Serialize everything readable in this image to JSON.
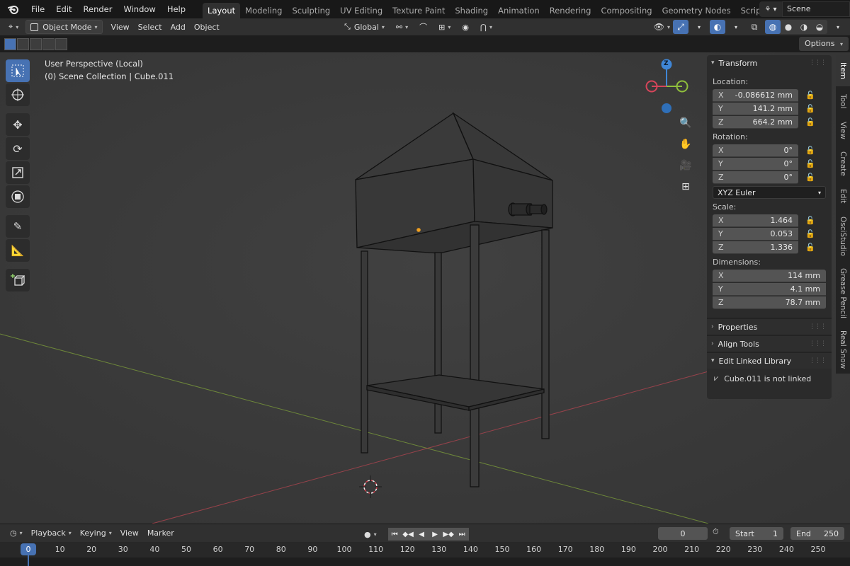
{
  "menu": {
    "items": [
      "File",
      "Edit",
      "Render",
      "Window",
      "Help"
    ]
  },
  "workspaces": {
    "tabs": [
      "Layout",
      "Modeling",
      "Sculpting",
      "UV Editing",
      "Texture Paint",
      "Shading",
      "Animation",
      "Rendering",
      "Compositing",
      "Geometry Nodes",
      "Scripting"
    ],
    "active": "Layout"
  },
  "scene": {
    "name": "Scene"
  },
  "viewport_header": {
    "mode": "Object Mode",
    "menus": [
      "View",
      "Select",
      "Add",
      "Object"
    ],
    "orientation": "Global"
  },
  "options_label": "Options",
  "viewport": {
    "perspective": "User Perspective (Local)",
    "collection": "(0) Scene Collection | Cube.011",
    "gizmo_axis": "Z"
  },
  "panel": {
    "transform_title": "Transform",
    "location_label": "Location:",
    "location": [
      {
        "axis": "X",
        "value": "-0.086612 mm"
      },
      {
        "axis": "Y",
        "value": "141.2 mm"
      },
      {
        "axis": "Z",
        "value": "664.2 mm"
      }
    ],
    "rotation_label": "Rotation:",
    "rotation": [
      {
        "axis": "X",
        "value": "0°"
      },
      {
        "axis": "Y",
        "value": "0°"
      },
      {
        "axis": "Z",
        "value": "0°"
      }
    ],
    "rotation_mode": "XYZ Euler",
    "scale_label": "Scale:",
    "scale": [
      {
        "axis": "X",
        "value": "1.464"
      },
      {
        "axis": "Y",
        "value": "0.053"
      },
      {
        "axis": "Z",
        "value": "1.336"
      }
    ],
    "dimensions_label": "Dimensions:",
    "dimensions": [
      {
        "axis": "X",
        "value": "114 mm"
      },
      {
        "axis": "Y",
        "value": "4.1 mm"
      },
      {
        "axis": "Z",
        "value": "78.7 mm"
      }
    ],
    "properties_title": "Properties",
    "align_tools_title": "Align Tools",
    "linked_library_title": "Edit Linked Library",
    "linked_status": "Cube.011 is not linked"
  },
  "side_tabs": [
    "Item",
    "Tool",
    "View",
    "Create",
    "Edit",
    "OsciStudio",
    "Grease Pencil",
    "Real Snow"
  ],
  "side_tab_active": "Item",
  "timeline": {
    "menus": [
      "Playback",
      "Keying",
      "View",
      "Marker"
    ],
    "current_frame": "0",
    "start_label": "Start",
    "start": "1",
    "end_label": "End",
    "end": "250",
    "ruler": [
      "0",
      "10",
      "20",
      "30",
      "40",
      "50",
      "60",
      "70",
      "80",
      "90",
      "100",
      "110",
      "120",
      "130",
      "140",
      "150",
      "160",
      "170",
      "180",
      "190",
      "200",
      "210",
      "220",
      "230",
      "240",
      "250"
    ]
  },
  "colors": {
    "accent": "#4772b3",
    "x_axis": "#d6455a",
    "y_axis": "#8fbf3c",
    "z_axis": "#3f86d6",
    "origin": "#f0a020"
  }
}
